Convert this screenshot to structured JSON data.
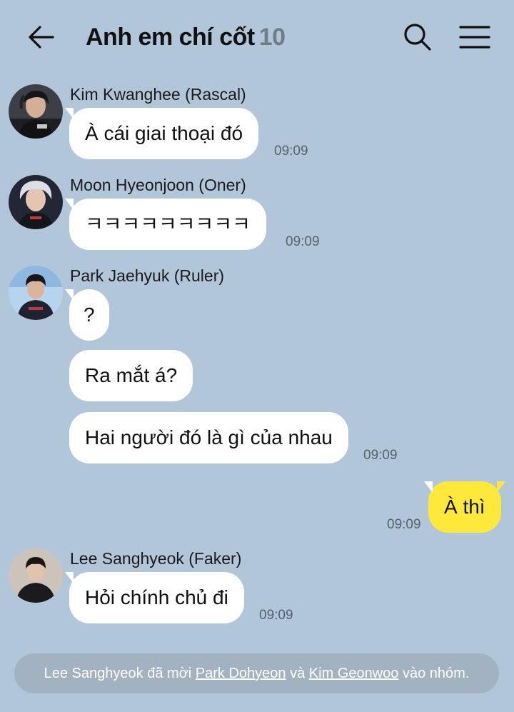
{
  "header": {
    "title": "Anh em chí cốt",
    "member_count": "10"
  },
  "messages": [
    {
      "sender": "Kim Kwanghee (Rascal)",
      "bubbles": [
        "À cái giai thoại đó"
      ],
      "time": "09:09"
    },
    {
      "sender": "Moon Hyeonjoon (Oner)",
      "bubbles": [
        "ㅋㅋㅋㅋㅋㅋㅋㅋㅋ"
      ],
      "time": "09:09"
    },
    {
      "sender": "Park Jaehyuk (Ruler)",
      "bubbles": [
        "?",
        "Ra mắt á?",
        "Hai người đó là gì của nhau"
      ],
      "time": "09:09"
    },
    {
      "sender": "Lee Sanghyeok (Faker)",
      "bubbles": [
        "Hỏi chính chủ đi"
      ],
      "time": "09:09"
    }
  ],
  "my_message": {
    "text": "À thì",
    "time": "09:09"
  },
  "notice": {
    "inviter": "Lee Sanghyeok",
    "invited_verb": "đã mời",
    "user1": "Park Dohyeon",
    "conjunction": "và",
    "user2": "Kim Geonwoo",
    "suffix": "vào nhóm."
  },
  "colors": {
    "background": "#b1c6d9",
    "my_bubble": "#fee93a",
    "other_bubble": "#ffffff",
    "notice_bg": "#a2b2c0"
  }
}
